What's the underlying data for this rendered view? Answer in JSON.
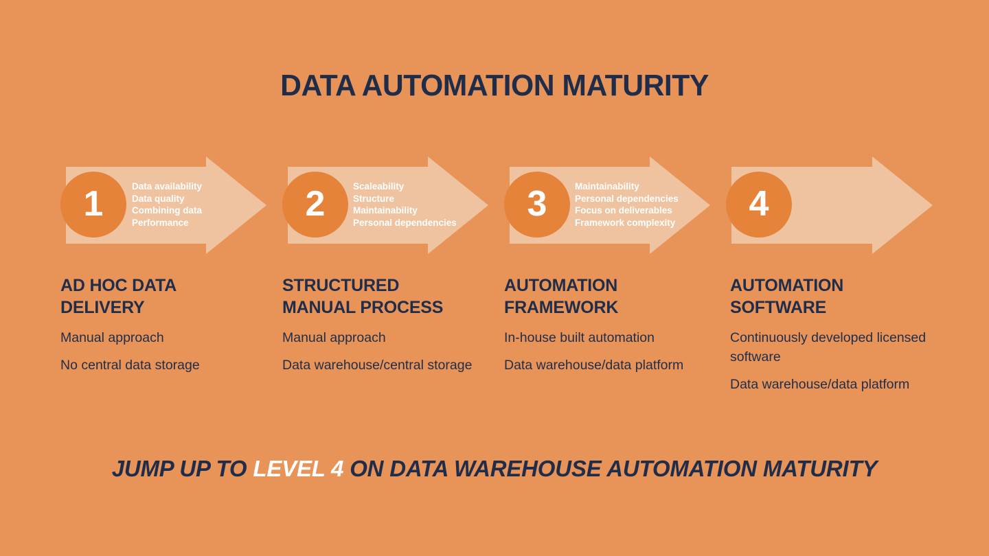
{
  "title": "DATA AUTOMATION MATURITY",
  "colors": {
    "background": "#e89458",
    "circle": "#e6833a",
    "arrow": "#efc3a0",
    "dark_text": "#1f2d4a",
    "light_text": "#ffffff"
  },
  "stages": [
    {
      "number": "1",
      "challenges": [
        "Data availability",
        "Data quality",
        "Combining data",
        "Performance"
      ],
      "heading_line1": "AD HOC DATA",
      "heading_line2": "DELIVERY",
      "facts": [
        "Manual approach",
        "No central data storage"
      ]
    },
    {
      "number": "2",
      "challenges": [
        "Scaleability",
        "Structure",
        "Maintainability",
        "Personal dependencies"
      ],
      "heading_line1": "STRUCTURED",
      "heading_line2": "MANUAL PROCESS",
      "facts": [
        "Manual approach",
        "Data warehouse/central storage"
      ]
    },
    {
      "number": "3",
      "challenges": [
        "Maintainability",
        "Personal dependencies",
        "Focus on deliverables",
        "Framework complexity"
      ],
      "heading_line1": "AUTOMATION",
      "heading_line2": "FRAMEWORK",
      "facts": [
        "In-house built automation",
        "Data warehouse/data platform"
      ]
    },
    {
      "number": "4",
      "challenges": [],
      "heading_line1": "AUTOMATION",
      "heading_line2": "SOFTWARE",
      "facts": [
        "Continuously developed licensed software",
        "Data warehouse/data platform"
      ]
    }
  ],
  "tagline": {
    "part1": "JUMP UP TO ",
    "highlight": "LEVEL 4",
    "part2": " ON DATA WAREHOUSE AUTOMATION MATURITY"
  }
}
